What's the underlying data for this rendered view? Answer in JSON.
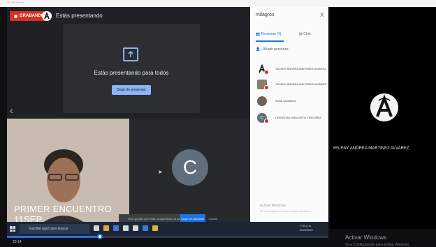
{
  "browser_strip": {
    "label": "— — — —"
  },
  "meet": {
    "recording_label": "GRABANDO",
    "presenting_label": "Estás presentando",
    "card": {
      "title": "Estás presentando para todos",
      "stop_button": "Dejar de presentar"
    },
    "video_caption": "PRIMER ENCUENTRO 11SEP",
    "video_subcaption": "Señal cambiante",
    "c_avatar_letter": "C",
    "toast": {
      "text": "meet.google.com está compartiendo tu pantalla",
      "action": "Dejar de compartir",
      "dismiss": "Ocultar"
    }
  },
  "panel": {
    "title": "milagros",
    "close": "X",
    "tab_people": "Personas (4)",
    "tab_chat": "Chat",
    "add_people": "Añadir personas",
    "participants": [
      {
        "name": "YELENY ANDREA MARTINEZ ALVAREZ",
        "avatar_color": "#ffffff"
      },
      {
        "name": "YELENY ANDREA MARTINEZ ALVAREZ",
        "avatar_color": "#8d7b6b"
      },
      {
        "name": "Señal cambiante",
        "avatar_color": "#6d6255"
      },
      {
        "name": "CHRISTIAN IVAN ORTIZ ORDOÑEZ",
        "avatar_color": "#5f6f7d"
      }
    ],
    "activate_small": "Activar Windows",
    "activate_small_sub": "Ve a Configuración para activar Windows."
  },
  "right_tile": {
    "name": "YELENY ANDREA MARTINEZ ALVAREZ"
  },
  "windows_watermark": {
    "title": "Activar Windows",
    "subtitle": "Ve a Configuración para activar Windows."
  },
  "taskbar": {
    "search_placeholder": "Escribe aquí para buscar",
    "time": "7:04 p.m.",
    "date": "11/09/2020"
  },
  "player": {
    "progress": 0.29,
    "time_code": "20:14"
  },
  "colors": {
    "accent": "#1a73e8",
    "recording": "#d93025"
  }
}
